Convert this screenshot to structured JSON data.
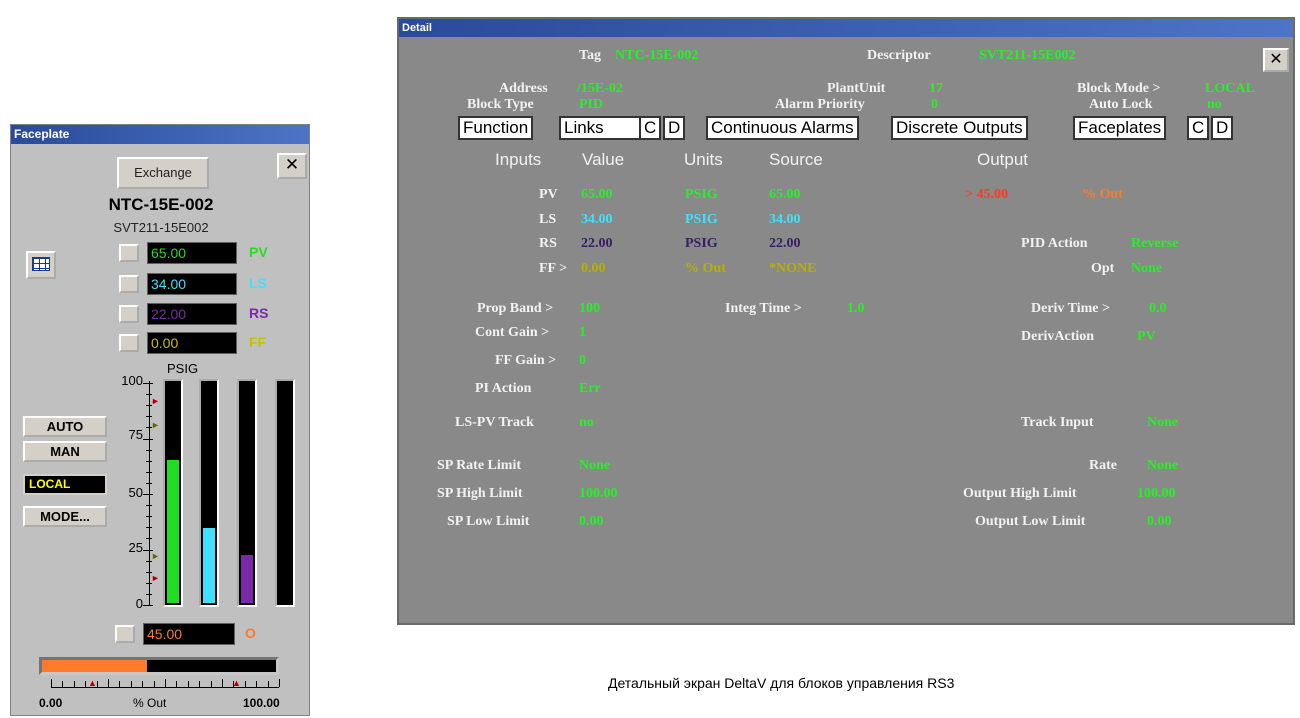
{
  "faceplate": {
    "title": "Faceplate",
    "close_label": "✕",
    "exchange_label": "Exchange",
    "tag": "NTC-15E-002",
    "descriptor": "SVT211-15E002",
    "rows": [
      {
        "value": "65.00",
        "label": "PV",
        "color": "#22dd22"
      },
      {
        "value": "34.00",
        "label": "LS",
        "color": "#40e0ff"
      },
      {
        "value": "22.00",
        "label": "RS",
        "color": "#7a2aa8"
      },
      {
        "value": "0.00",
        "label": "FF",
        "color": "#c8c000"
      }
    ],
    "units": "PSIG",
    "axis_ticks": [
      "100",
      "75",
      "50",
      "25",
      "0"
    ],
    "bars": [
      {
        "name": "PV",
        "level": 65,
        "color": "#22dd22"
      },
      {
        "name": "LS",
        "level": 34,
        "color": "#40e0ff"
      },
      {
        "name": "RS",
        "level": 22,
        "color": "#7a2aa8"
      },
      {
        "name": "FF",
        "level": 0,
        "color": "#c8c000"
      }
    ],
    "modes": {
      "auto": "AUTO",
      "man": "MAN",
      "local": "LOCAL",
      "mode": "MODE..."
    },
    "output": {
      "value": "45.00",
      "label": "O",
      "color": "#ff7a2a",
      "level": 45
    },
    "scale": {
      "min": "0.00",
      "unit": "% Out",
      "max": "100.00"
    }
  },
  "detail": {
    "title": "Detail",
    "close_label": "✕",
    "tag_label": "Tag",
    "tag_value": "NTC-15E-002",
    "descriptor_label": "Descriptor",
    "descriptor_value": "SVT211-15E002",
    "address_label": "Address",
    "address_value": "/15E-02",
    "plant_label": "PlantUnit",
    "plant_value": "17",
    "block_mode_label": "Block Mode >",
    "block_mode_value": "LOCAL",
    "block_type_label": "Block Type",
    "block_type_value": "PID",
    "alarm_priority_label": "Alarm Priority",
    "alarm_priority_value": "0",
    "auto_lock_label": "Auto Lock",
    "auto_lock_value": "no",
    "tabs": {
      "function": "Function",
      "links": "Links",
      "c1": "C",
      "d1": "D",
      "cont_alarms": "Continuous Alarms",
      "disc_outputs": "Discrete Outputs",
      "faceplates": "Faceplates",
      "c2": "C",
      "d2": "D"
    },
    "headers": {
      "inputs": "Inputs",
      "value": "Value",
      "units": "Units",
      "source": "Source",
      "output": "Output"
    },
    "inputs": [
      {
        "name": "PV",
        "value": "65.00",
        "units": "PSIG",
        "source": "65.00"
      },
      {
        "name": "LS",
        "value": "34.00",
        "units": "PSIG",
        "source": "34.00"
      },
      {
        "name": "RS",
        "value": "22.00",
        "units": "PSIG",
        "source": "22.00"
      },
      {
        "name": "FF >",
        "value": "0.00",
        "units": "% Out",
        "source": "*NONE"
      }
    ],
    "output_value": "> 45.00",
    "output_units": "% Out",
    "pid_action_label": "PID Action",
    "pid_action_value": "Reverse",
    "opt_label": "Opt",
    "opt_value": "None",
    "prop_band_label": "Prop Band >",
    "prop_band_value": "100",
    "integ_time_label": "Integ Time >",
    "integ_time_value": "1.0",
    "deriv_time_label": "Deriv Time >",
    "deriv_time_value": "0.0",
    "cont_gain_label": "Cont Gain >",
    "cont_gain_value": "1",
    "deriv_action_label": "DerivAction",
    "deriv_action_value": "PV",
    "ff_gain_label": "FF Gain >",
    "ff_gain_value": "0",
    "pi_action_label": "PI Action",
    "pi_action_value": "Err",
    "ls_pv_label": "LS-PV Track",
    "ls_pv_value": "no",
    "track_input_label": "Track Input",
    "track_input_value": "None",
    "sp_rate_label": "SP Rate Limit",
    "sp_rate_value": "None",
    "rate_label": "Rate",
    "rate_value": "None",
    "sp_high_label": "SP High Limit",
    "sp_high_value": "100.00",
    "out_high_label": "Output High Limit",
    "out_high_value": "100.00",
    "sp_low_label": "SP Low Limit",
    "sp_low_value": "0.00",
    "out_low_label": "Output Low Limit",
    "out_low_value": "0.00"
  },
  "caption": "Детальный экран DeltaV для блоков управления RS3"
}
